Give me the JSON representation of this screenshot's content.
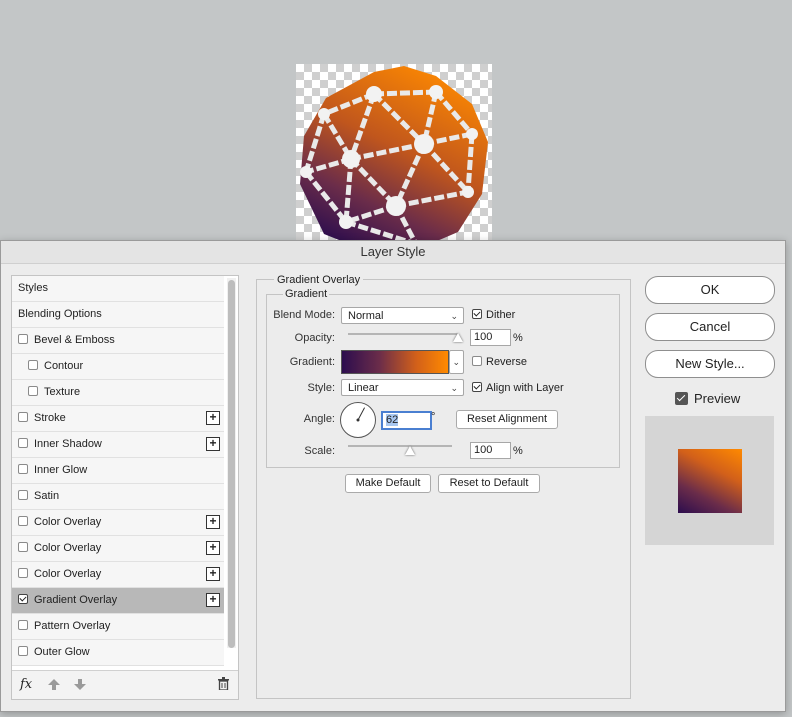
{
  "dialog": {
    "title": "Layer Style"
  },
  "styles_list": {
    "items": [
      {
        "label": "Styles",
        "checkbox": false,
        "checked": false,
        "plus": false,
        "indent": false,
        "selected": false
      },
      {
        "label": "Blending Options",
        "checkbox": false,
        "checked": false,
        "plus": false,
        "indent": false,
        "selected": false
      },
      {
        "label": "Bevel & Emboss",
        "checkbox": true,
        "checked": false,
        "plus": false,
        "indent": false,
        "selected": false
      },
      {
        "label": "Contour",
        "checkbox": true,
        "checked": false,
        "plus": false,
        "indent": true,
        "selected": false
      },
      {
        "label": "Texture",
        "checkbox": true,
        "checked": false,
        "plus": false,
        "indent": true,
        "selected": false
      },
      {
        "label": "Stroke",
        "checkbox": true,
        "checked": false,
        "plus": true,
        "indent": false,
        "selected": false
      },
      {
        "label": "Inner Shadow",
        "checkbox": true,
        "checked": false,
        "plus": true,
        "indent": false,
        "selected": false
      },
      {
        "label": "Inner Glow",
        "checkbox": true,
        "checked": false,
        "plus": false,
        "indent": false,
        "selected": false
      },
      {
        "label": "Satin",
        "checkbox": true,
        "checked": false,
        "plus": false,
        "indent": false,
        "selected": false
      },
      {
        "label": "Color Overlay",
        "checkbox": true,
        "checked": false,
        "plus": true,
        "indent": false,
        "selected": false
      },
      {
        "label": "Color Overlay",
        "checkbox": true,
        "checked": false,
        "plus": true,
        "indent": false,
        "selected": false
      },
      {
        "label": "Color Overlay",
        "checkbox": true,
        "checked": false,
        "plus": true,
        "indent": false,
        "selected": false
      },
      {
        "label": "Gradient Overlay",
        "checkbox": true,
        "checked": true,
        "plus": true,
        "indent": false,
        "selected": true
      },
      {
        "label": "Pattern Overlay",
        "checkbox": true,
        "checked": false,
        "plus": false,
        "indent": false,
        "selected": false
      },
      {
        "label": "Outer Glow",
        "checkbox": true,
        "checked": false,
        "plus": false,
        "indent": false,
        "selected": false
      }
    ],
    "footer": {
      "fx_label": "fx"
    }
  },
  "gradient_overlay": {
    "section_title": "Gradient Overlay",
    "group_title": "Gradient",
    "blend_mode": {
      "label": "Blend Mode:",
      "value": "Normal"
    },
    "dither": {
      "label": "Dither",
      "checked": true
    },
    "opacity": {
      "label": "Opacity:",
      "value": "100",
      "unit": "%",
      "slider_fraction": 1.0
    },
    "gradient": {
      "label": "Gradient:",
      "colors": [
        "#2c0d4e",
        "#6a2c4a",
        "#d2601a",
        "#ff8a00"
      ]
    },
    "reverse": {
      "label": "Reverse",
      "checked": false
    },
    "style": {
      "label": "Style:",
      "value": "Linear"
    },
    "align_with_layer": {
      "label": "Align with Layer",
      "checked": true
    },
    "angle": {
      "label": "Angle:",
      "value": "62",
      "unit": "°"
    },
    "reset_alignment_label": "Reset Alignment",
    "scale": {
      "label": "Scale:",
      "value": "100",
      "unit": "%",
      "slider_fraction": 0.6
    },
    "make_default_label": "Make Default",
    "reset_to_default_label": "Reset to Default"
  },
  "right": {
    "ok_label": "OK",
    "cancel_label": "Cancel",
    "new_style_label": "New Style...",
    "preview": {
      "label": "Preview",
      "checked": true
    }
  }
}
